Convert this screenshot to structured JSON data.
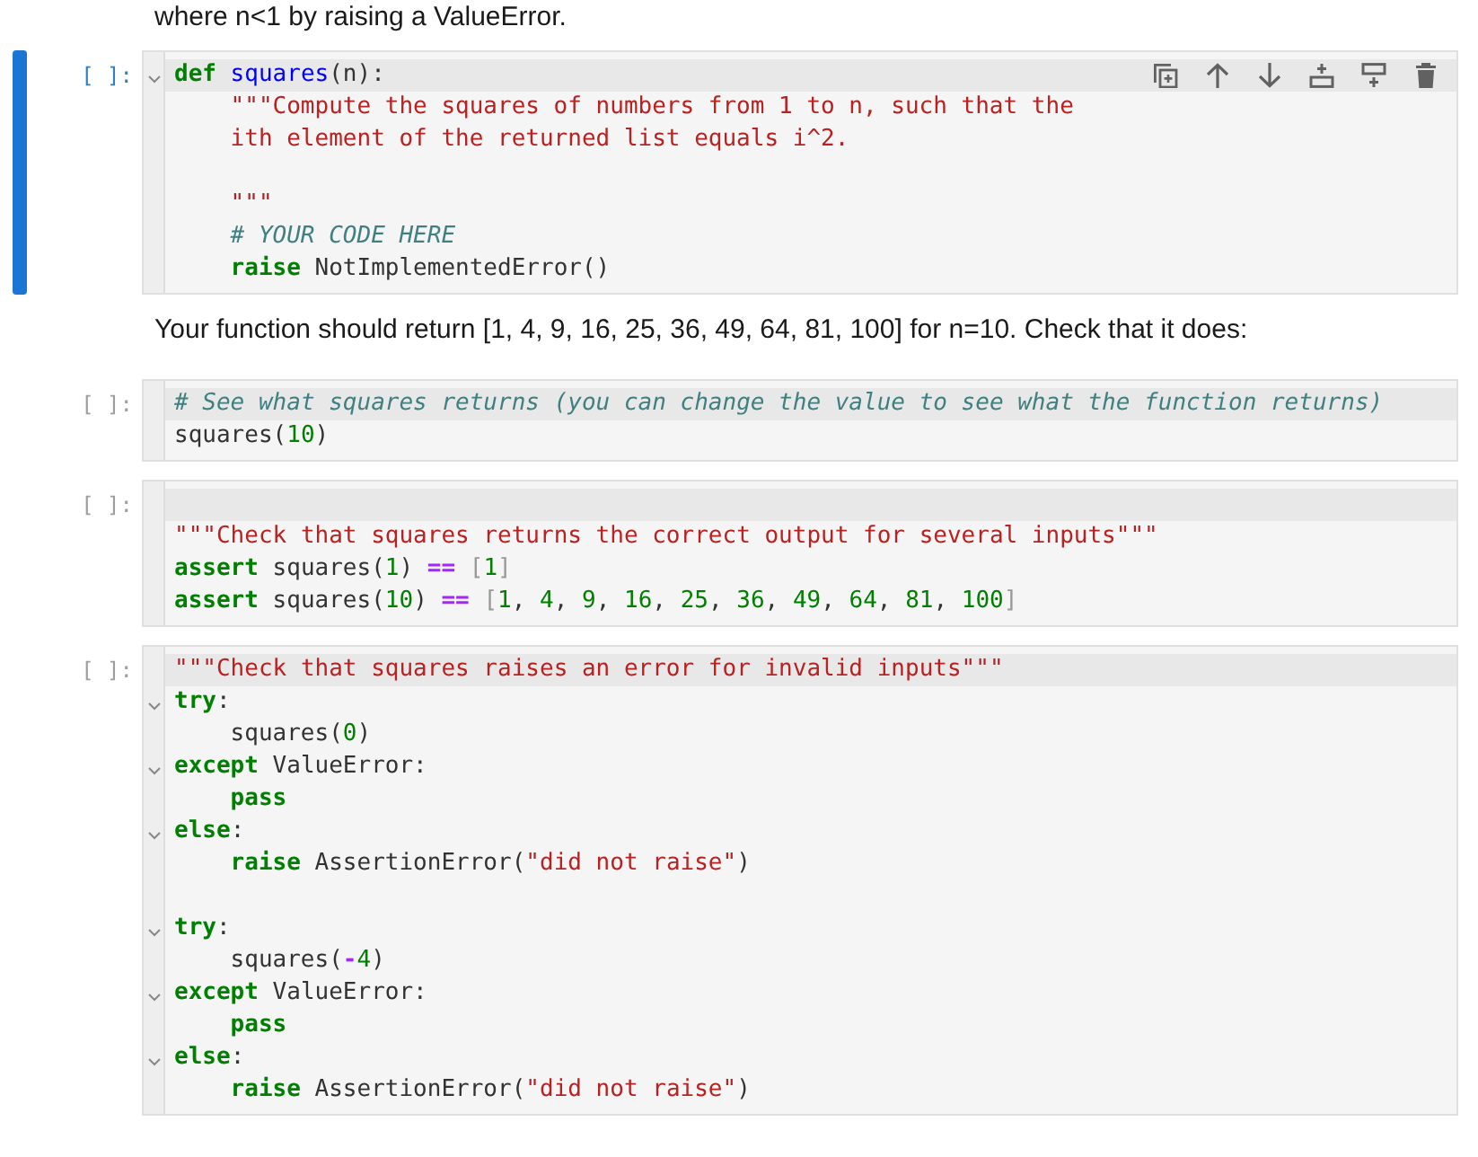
{
  "items": [
    {
      "kind": "markdown",
      "text": "where n<1 by raising a ValueError."
    },
    {
      "kind": "code",
      "prompt": "[ ]:",
      "selected": true,
      "lines": [
        {
          "fold": true,
          "active": true,
          "indented": false,
          "tokens": [
            {
              "kind": "kw",
              "text": "def"
            },
            {
              "kind": "fn",
              "text": " squares"
            },
            {
              "kind": "p",
              "text": "(n):"
            }
          ]
        },
        {
          "fold": false,
          "active": false,
          "indented": true,
          "tokens": [
            {
              "kind": "str",
              "text": "\"\"\"Compute the squares of numbers from 1 to n, such that the"
            }
          ]
        },
        {
          "fold": false,
          "active": false,
          "indented": true,
          "tokens": [
            {
              "kind": "str",
              "text": "ith element of the returned list equals i^2."
            }
          ]
        },
        {
          "fold": false,
          "active": false
        },
        {
          "fold": false,
          "active": false,
          "indented": true,
          "tokens": [
            {
              "kind": "str",
              "text": "\"\"\""
            }
          ]
        },
        {
          "fold": false,
          "active": false,
          "indented": true,
          "tokens": [
            {
              "kind": "cm",
              "text": "# YOUR CODE HERE"
            }
          ]
        },
        {
          "fold": false,
          "active": false,
          "indented": true,
          "tokens": [
            {
              "kind": "kw",
              "text": "raise"
            },
            {
              "kind": "p",
              "text": " NotImplementedError()"
            }
          ]
        }
      ]
    },
    {
      "kind": "markdown",
      "text": "Your function should return [1, 4, 9, 16, 25, 36, 49, 64, 81, 100] for n=10. Check that it does:"
    },
    {
      "kind": "code",
      "prompt": "[ ]:",
      "selected": false,
      "lines": [
        {
          "fold": false,
          "active": true,
          "indented": false,
          "tokens": [
            {
              "kind": "cm",
              "text": "# See what squares returns (you can change the value to see what the function returns)"
            }
          ]
        },
        {
          "fold": false,
          "active": false,
          "indented": false,
          "tokens": [
            {
              "kind": "p",
              "text": "squares("
            },
            {
              "kind": "num",
              "text": "10"
            },
            {
              "kind": "p",
              "text": ")"
            }
          ]
        }
      ]
    },
    {
      "kind": "code",
      "prompt": "[ ]:",
      "selected": false,
      "lines": [
        {
          "fold": false,
          "active": true
        },
        {
          "fold": false,
          "active": false,
          "indented": false,
          "tokens": [
            {
              "kind": "str",
              "text": "\"\"\"Check that squares returns the correct output for several inputs\"\"\""
            }
          ]
        },
        {
          "fold": false,
          "active": false,
          "indented": false,
          "tokens": [
            {
              "kind": "kw",
              "text": "assert"
            },
            {
              "kind": "p",
              "text": " squares("
            },
            {
              "kind": "num",
              "text": "1"
            },
            {
              "kind": "p",
              "text": ") "
            },
            {
              "kind": "op",
              "text": "=="
            },
            {
              "kind": "br",
              "text": " ["
            },
            {
              "kind": "num",
              "text": "1"
            },
            {
              "kind": "br",
              "text": "]"
            }
          ]
        },
        {
          "fold": false,
          "active": false,
          "indented": false,
          "tokens": [
            {
              "kind": "kw",
              "text": "assert"
            },
            {
              "kind": "p",
              "text": " squares("
            },
            {
              "kind": "num",
              "text": "10"
            },
            {
              "kind": "p",
              "text": ") "
            },
            {
              "kind": "op",
              "text": "=="
            },
            {
              "kind": "br",
              "text": " ["
            },
            {
              "kind": "num",
              "text": "1"
            },
            {
              "kind": "p",
              "text": ", "
            },
            {
              "kind": "num",
              "text": "4"
            },
            {
              "kind": "p",
              "text": ", "
            },
            {
              "kind": "num",
              "text": "9"
            },
            {
              "kind": "p",
              "text": ", "
            },
            {
              "kind": "num",
              "text": "16"
            },
            {
              "kind": "p",
              "text": ", "
            },
            {
              "kind": "num",
              "text": "25"
            },
            {
              "kind": "p",
              "text": ", "
            },
            {
              "kind": "num",
              "text": "36"
            },
            {
              "kind": "p",
              "text": ", "
            },
            {
              "kind": "num",
              "text": "49"
            },
            {
              "kind": "p",
              "text": ", "
            },
            {
              "kind": "num",
              "text": "64"
            },
            {
              "kind": "p",
              "text": ", "
            },
            {
              "kind": "num",
              "text": "81"
            },
            {
              "kind": "p",
              "text": ", "
            },
            {
              "kind": "num",
              "text": "100"
            },
            {
              "kind": "br",
              "text": "]"
            }
          ]
        }
      ]
    },
    {
      "kind": "code",
      "prompt": "[ ]:",
      "selected": false,
      "lines": [
        {
          "fold": false,
          "active": true,
          "indented": false,
          "tokens": [
            {
              "kind": "str",
              "text": "\"\"\"Check that squares raises an error for invalid inputs\"\"\""
            }
          ]
        },
        {
          "fold": true,
          "active": false,
          "indented": false,
          "tokens": [
            {
              "kind": "kw",
              "text": "try"
            },
            {
              "kind": "p",
              "text": ":"
            }
          ]
        },
        {
          "fold": false,
          "active": false,
          "indented": true,
          "tokens": [
            {
              "kind": "p",
              "text": "squares("
            },
            {
              "kind": "num",
              "text": "0"
            },
            {
              "kind": "p",
              "text": ")"
            }
          ]
        },
        {
          "fold": true,
          "active": false,
          "indented": false,
          "tokens": [
            {
              "kind": "kw",
              "text": "except"
            },
            {
              "kind": "p",
              "text": " ValueError:"
            }
          ]
        },
        {
          "fold": false,
          "active": false,
          "indented": true,
          "tokens": [
            {
              "kind": "kw",
              "text": "pass"
            }
          ]
        },
        {
          "fold": true,
          "active": false,
          "indented": false,
          "tokens": [
            {
              "kind": "kw",
              "text": "else"
            },
            {
              "kind": "p",
              "text": ":"
            }
          ]
        },
        {
          "fold": false,
          "active": false,
          "indented": true,
          "tokens": [
            {
              "kind": "kw",
              "text": "raise"
            },
            {
              "kind": "p",
              "text": " AssertionError("
            },
            {
              "kind": "str",
              "text": "\"did not raise\""
            },
            {
              "kind": "p",
              "text": ")"
            }
          ]
        },
        {
          "fold": false,
          "active": false
        },
        {
          "fold": true,
          "active": false,
          "indented": false,
          "tokens": [
            {
              "kind": "kw",
              "text": "try"
            },
            {
              "kind": "p",
              "text": ":"
            }
          ]
        },
        {
          "fold": false,
          "active": false,
          "indented": true,
          "tokens": [
            {
              "kind": "p",
              "text": "squares("
            },
            {
              "kind": "op",
              "text": "-"
            },
            {
              "kind": "num",
              "text": "4"
            },
            {
              "kind": "p",
              "text": ")"
            }
          ]
        },
        {
          "fold": true,
          "active": false,
          "indented": false,
          "tokens": [
            {
              "kind": "kw",
              "text": "except"
            },
            {
              "kind": "p",
              "text": " ValueError:"
            }
          ]
        },
        {
          "fold": false,
          "active": false,
          "indented": true,
          "tokens": [
            {
              "kind": "kw",
              "text": "pass"
            }
          ]
        },
        {
          "fold": true,
          "active": false,
          "indented": false,
          "tokens": [
            {
              "kind": "kw",
              "text": "else"
            },
            {
              "kind": "p",
              "text": ":"
            }
          ]
        },
        {
          "fold": false,
          "active": false,
          "indented": true,
          "tokens": [
            {
              "kind": "kw",
              "text": "raise"
            },
            {
              "kind": "p",
              "text": " AssertionError("
            },
            {
              "kind": "str",
              "text": "\"did not raise\""
            },
            {
              "kind": "p",
              "text": ")"
            }
          ]
        }
      ]
    }
  ]
}
